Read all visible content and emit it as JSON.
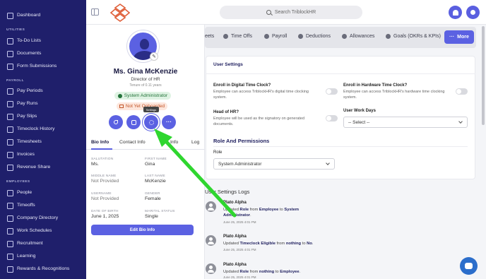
{
  "sidebar": {
    "items": [
      {
        "label": "Dashboard",
        "icon": "dashboard-icon"
      },
      {
        "label": "To-Do Lists",
        "icon": "todo-icon"
      },
      {
        "label": "Documents",
        "icon": "documents-icon"
      },
      {
        "label": "Form Submissions",
        "icon": "form-icon"
      },
      {
        "label": "Pay Periods",
        "icon": "calendar-icon"
      },
      {
        "label": "Pay Runs",
        "icon": "payrun-icon"
      },
      {
        "label": "Pay Slips",
        "icon": "payslip-icon"
      },
      {
        "label": "Timeclock History",
        "icon": "clock-icon"
      },
      {
        "label": "Timesheets",
        "icon": "timesheet-icon"
      },
      {
        "label": "Invoices",
        "icon": "invoice-icon"
      },
      {
        "label": "Revenue Share",
        "icon": "revenue-icon"
      },
      {
        "label": "People",
        "icon": "people-icon"
      },
      {
        "label": "Timeoffs",
        "icon": "plane-icon"
      },
      {
        "label": "Company Directory",
        "icon": "directory-icon"
      },
      {
        "label": "Work Schedules",
        "icon": "schedule-icon"
      },
      {
        "label": "Recruitment",
        "icon": "recruitment-icon"
      },
      {
        "label": "Learning",
        "icon": "learning-icon"
      },
      {
        "label": "Rewards & Recognitions",
        "icon": "rewards-icon"
      }
    ],
    "sections": {
      "utilities": "UTILITIES",
      "payroll": "PAYROLL",
      "employees": "EMPLOYEES"
    }
  },
  "topbar": {
    "search_placeholder": "Search TriblockHR"
  },
  "profile": {
    "name": "Ms. Gina McKenzie",
    "title": "Director of HR",
    "tenure": "Tenure of 0.11 years",
    "role_badge": "System Administrator",
    "onboard_badge": "Not Yet Onboarded",
    "tooltip": "Settings",
    "tabs": [
      "Bio Info",
      "Contact Info",
      "Info",
      "Log"
    ],
    "fields": {
      "salutation_label": "SALUTATION",
      "salutation": "Ms.",
      "first_name_label": "FIRST NAME",
      "first_name": "Gina",
      "middle_name_label": "MIDDLE NAME",
      "middle_name": "Not Provided",
      "last_name_label": "LAST NAME",
      "last_name": "McKenzie",
      "username_label": "USERNAME",
      "username": "Not Provided",
      "gender_label": "GENDER",
      "gender": "Female",
      "dob_label": "DATE OF BIRTH",
      "dob": "June 1, 2025",
      "marital_label": "MARITAL STATUS",
      "marital": "Single"
    },
    "edit_button": "Edit Bio Info"
  },
  "main_tabs": [
    {
      "label": "eets"
    },
    {
      "label": "Time Offs"
    },
    {
      "label": "Payroll"
    },
    {
      "label": "Deductions"
    },
    {
      "label": "Allowances"
    },
    {
      "label": "Goals (OKRs & KPIs)"
    }
  ],
  "more_button": "More",
  "user_settings": {
    "title": "User Settings",
    "digital_label": "Enroll in Digital Time Clock?",
    "digital_desc": "Employee can access TriblockHR's digital time clocking system.",
    "hardware_label": "Enroll in Hardware Time Clock?",
    "hardware_desc": "Employee can access TriblockHR's hardware time clocking system.",
    "head_label": "Head of HR?",
    "head_desc": "Employee will be used as the signatory on generated documents.",
    "schedule_label": "User Work Days",
    "schedule_value": "-- Select --",
    "roles_title": "Role And Permissions",
    "role_label": "Role",
    "role_value": "System Administrator"
  },
  "logs": {
    "title": "User Settings Logs",
    "entries": [
      {
        "name": "Plato Alpha",
        "time": "June 25, 2025 4:01 PM"
      },
      {
        "name": "Plato Alpha",
        "time": "June 25, 2025 4:01 PM"
      },
      {
        "name": "Plato Alpha",
        "time": "June 25, 2025 4:01 PM"
      }
    ],
    "texts": [
      {
        "pre": "Updated ",
        "field": "Role",
        "mid": " from ",
        "from": "Employee",
        "to_word": " to ",
        "to": "System Administrator",
        "end": "."
      },
      {
        "pre": "Updated ",
        "field": "Timeclock Eligible",
        "mid": " from ",
        "from": "nothing",
        "to_word": " to ",
        "to": "No",
        "end": "."
      },
      {
        "pre": "Updated ",
        "field": "Role",
        "mid": " from ",
        "from": "nothing",
        "to_word": " to ",
        "to": "Employee",
        "end": "."
      }
    ]
  },
  "colors": {
    "sidebar": "#1f1f6b",
    "accent": "#5b61e2",
    "arrow": "#2fd62f"
  }
}
